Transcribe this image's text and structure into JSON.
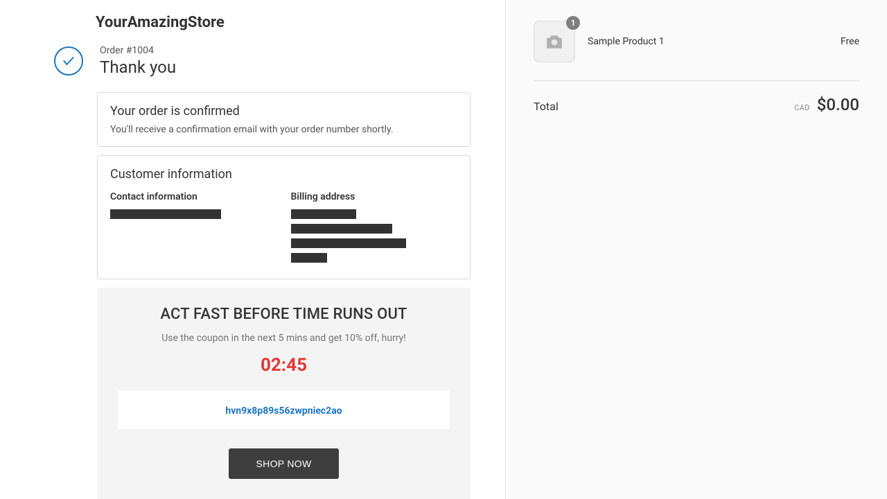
{
  "store": {
    "name": "YourAmazingStore"
  },
  "order": {
    "number_label": "Order #1004",
    "thank_you": "Thank you"
  },
  "confirmed": {
    "title": "Your order is confirmed",
    "subtext": "You'll receive a confirmation email with your order number shortly."
  },
  "customer": {
    "title": "Customer information",
    "contact_label": "Contact information",
    "billing_label": "Billing address"
  },
  "promo": {
    "headline": "ACT FAST BEFORE TIME RUNS OUT",
    "subtext": "Use the coupon in the next 5 mins and get 10% off, hurry!",
    "timer": "02:45",
    "coupon_code": "hvn9x8p89s56zwpniec2ao",
    "button_label": "SHOP NOW"
  },
  "cart": {
    "product": {
      "name": "Sample Product 1",
      "price": "Free",
      "qty": "1"
    },
    "total_label": "Total",
    "currency": "CAD",
    "amount": "$0.00"
  }
}
